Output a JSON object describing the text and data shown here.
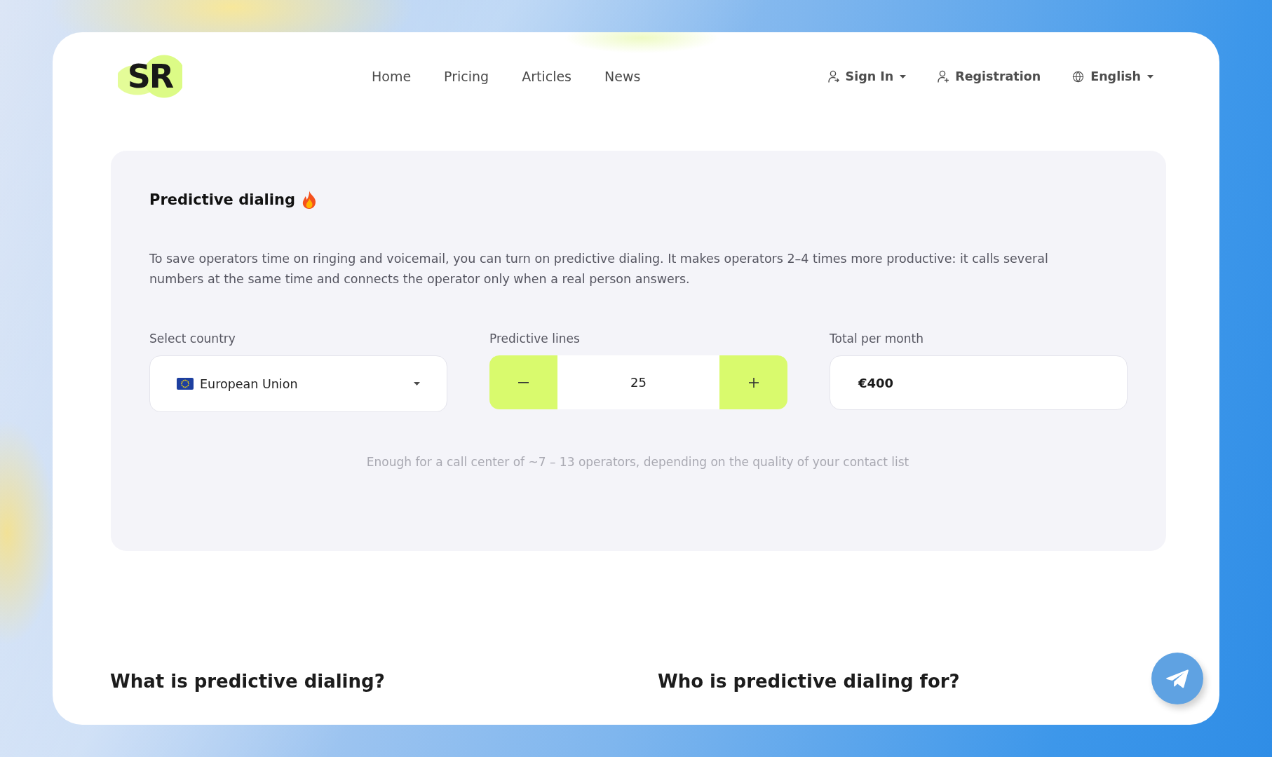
{
  "logo": {
    "text": "SR"
  },
  "nav": {
    "links": [
      {
        "label": "Home"
      },
      {
        "label": "Pricing"
      },
      {
        "label": "Articles"
      },
      {
        "label": "News"
      }
    ]
  },
  "account": [
    {
      "kind": "sign_in",
      "label": "Sign In"
    },
    {
      "kind": "register",
      "label": "Registration"
    },
    {
      "kind": "language",
      "label": "English"
    }
  ],
  "calculator": {
    "title": "Predictive dialing",
    "description": "To save operators time on ringing and voicemail, you can turn on predictive dialing. It makes operators 2–4 times more productive: it calls several numbers at the same time and connects the operator only when a real person answers.",
    "fields": [
      {
        "kind": "select",
        "label": "Select country",
        "value": "European Union"
      },
      {
        "kind": "stepper",
        "label": "Predictive lines",
        "value": "25"
      },
      {
        "kind": "total",
        "label": "Total per month",
        "value": "€400"
      }
    ],
    "hint": "Enough for a call center of ~7 – 13 operators, depending on the quality of your contact list"
  },
  "sections": [
    {
      "heading": "What is predictive dialing?"
    },
    {
      "heading": "Who is predictive dialing for?"
    }
  ]
}
